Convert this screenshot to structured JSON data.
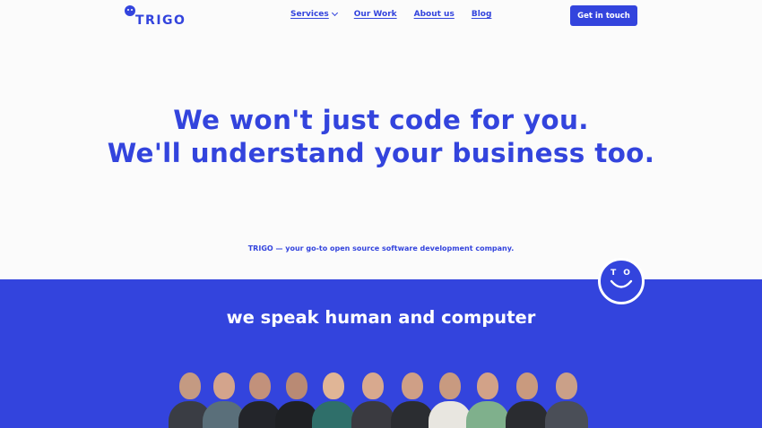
{
  "header": {
    "logo_text": "TRIGO",
    "nav": [
      {
        "label": "Services",
        "has_dropdown": true
      },
      {
        "label": "Our Work"
      },
      {
        "label": "About us"
      },
      {
        "label": "Blog"
      }
    ],
    "cta_label": "Get in touch"
  },
  "hero": {
    "title_line1": "We won't just code for you.",
    "title_line2": "We'll understand your business too.",
    "subtitle": "TRIGO — your go-to open source software development company."
  },
  "section": {
    "title": "we speak human and computer",
    "badge_letters": "TO"
  },
  "team": {
    "count": 11,
    "description": "team photo of eleven people"
  },
  "colors": {
    "brand": "#3344dd",
    "background": "#fbfbfb",
    "on_brand": "#ffffff"
  }
}
